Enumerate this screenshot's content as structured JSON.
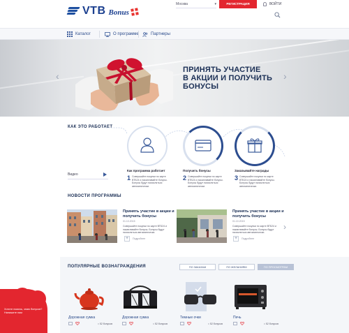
{
  "header": {
    "logo_text": "VTB",
    "logo_bonus": "Bonus",
    "city": "Москва",
    "register_label": "РЕГИСТРАЦИЯ",
    "login_label": "ВОЙТИ"
  },
  "nav": {
    "items": [
      {
        "label": "Каталог",
        "icon": "grid-icon"
      },
      {
        "label": "О программе",
        "icon": "monitor-icon"
      },
      {
        "label": "Партнеры",
        "icon": "people-icon"
      }
    ]
  },
  "hero": {
    "title_line1": "ПРИНЯТЬ УЧАСТИЕ",
    "title_line2": "В АКЦИИ И ПОЛУЧИТЬ",
    "title_line3": "БОНУСЫ"
  },
  "how_it_works": {
    "heading": "КАК ЭТО РАБОТАЕТ",
    "video_label": "Видео",
    "steps": [
      {
        "number": "1",
        "title": "Как программа работает",
        "icon": "user-icon",
        "desc": "Совершайте покупки по карте ВТБ24 и накапливайте бонусы. Бонусы будут начисляться автоматически."
      },
      {
        "number": "2",
        "title": "Получить бонусы",
        "icon": "card-icon",
        "desc": "Совершайте покупки по карте ВТБ24 и накапливайте бонусы. Бонусы будут начисляться автоматически."
      },
      {
        "number": "3",
        "title": "Заказывайте награды",
        "icon": "gift-icon",
        "desc": "Совершайте покупки по карте ВТБ24 и накапливайте бонусы. Бонусы будут начисляться автоматически."
      }
    ]
  },
  "news": {
    "heading": "НОВОСТИ ПРОГРАММЫ",
    "items": [
      {
        "title": "Принять участие в акции и получить бонусы",
        "date": "01.10.2015",
        "text": "Совершайте покупки по карте ВТБ24 и накапливайте бонусы. Бонусы будут начисляться автоматически.",
        "more": "Подробнее"
      },
      {
        "title": "Принять участие в акции и получить бонусы",
        "date": "01.10.2015",
        "text": "Совершайте покупки по карте ВТБ24 и накапливайте бонусы. Бонусы будут начисляться автоматически.",
        "more": "Подробнее"
      }
    ]
  },
  "rewards": {
    "heading": "ПОПУЛЯРНЫЕ ВОЗНАГРАЖДЕНИЯ",
    "tabs": [
      "ПО ЗАКАЗАМ",
      "ПО ЖЕЛАНИЯМ",
      "ПО ПРОСМОТРАМ"
    ],
    "products": [
      {
        "name": "Дорожная сумка",
        "price": "≈ 52 бонусов"
      },
      {
        "name": "Дорожная сумка",
        "price": "≈ 52 бонусов"
      },
      {
        "name": "Темные очки",
        "price": "≈ 52 бонусов"
      },
      {
        "name": "Печь",
        "price": "≈ 52 бонусов"
      }
    ]
  },
  "chat": {
    "text": "Хотите помочь, знаю бонусов? Напишите нам"
  },
  "colors": {
    "brand_blue": "#1b3f8f",
    "accent_red": "#e3262f"
  }
}
